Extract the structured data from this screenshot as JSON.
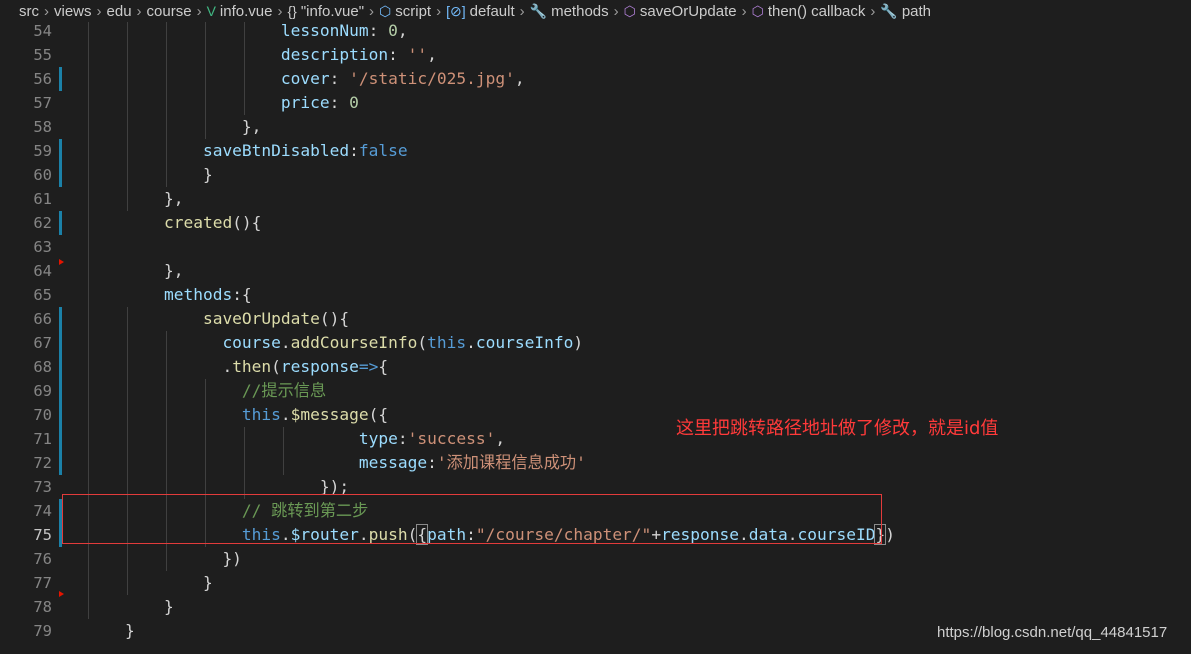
{
  "breadcrumb": [
    {
      "label": "src",
      "icon": ""
    },
    {
      "label": "views",
      "icon": ""
    },
    {
      "label": "edu",
      "icon": ""
    },
    {
      "label": "course",
      "icon": ""
    },
    {
      "label": "info.vue",
      "icon": "vue-file-icon",
      "glyph": "V",
      "color": "#41b883"
    },
    {
      "label": "\"info.vue\"",
      "icon": "object-braces-icon",
      "glyph": "{}",
      "color": "#cccccc"
    },
    {
      "label": "script",
      "icon": "cube-icon",
      "glyph": "⬡",
      "color": "#75beff"
    },
    {
      "label": "default",
      "icon": "bracket-symbol-icon",
      "glyph": "[⊘]",
      "color": "#75beff"
    },
    {
      "label": "methods",
      "icon": "wrench-icon",
      "glyph": "🔧",
      "color": "#cccccc"
    },
    {
      "label": "saveOrUpdate",
      "icon": "method-cube-icon",
      "glyph": "⬡",
      "color": "#b180d7"
    },
    {
      "label": "then() callback",
      "icon": "method-cube-icon",
      "glyph": "⬡",
      "color": "#b180d7"
    },
    {
      "label": "path",
      "icon": "wrench-icon",
      "glyph": "🔧",
      "color": "#cccccc"
    }
  ],
  "editor": {
    "active_line": 75,
    "lines": [
      {
        "n": 54,
        "t": [
          [
            "v",
            "                    lessonNum"
          ],
          [
            "p",
            ": "
          ],
          [
            "n",
            "0"
          ],
          [
            "p",
            ","
          ]
        ]
      },
      {
        "n": 55,
        "t": [
          [
            "v",
            "                    description"
          ],
          [
            "p",
            ": "
          ],
          [
            "s",
            "''"
          ],
          [
            "p",
            ","
          ]
        ]
      },
      {
        "n": 56,
        "t": [
          [
            "v",
            "                    cover"
          ],
          [
            "p",
            ": "
          ],
          [
            "s",
            "'/static/025.jpg'"
          ],
          [
            "p",
            ","
          ]
        ]
      },
      {
        "n": 57,
        "t": [
          [
            "v",
            "                    price"
          ],
          [
            "p",
            ": "
          ],
          [
            "n",
            "0"
          ]
        ]
      },
      {
        "n": 58,
        "t": [
          [
            "p",
            "                },"
          ]
        ]
      },
      {
        "n": 59,
        "t": [
          [
            "v",
            "            saveBtnDisabled"
          ],
          [
            "p",
            ":"
          ],
          [
            "k",
            "false"
          ]
        ]
      },
      {
        "n": 60,
        "t": [
          [
            "p",
            "            }"
          ]
        ]
      },
      {
        "n": 61,
        "t": [
          [
            "p",
            "        },"
          ]
        ]
      },
      {
        "n": 62,
        "t": [
          [
            "f",
            "        created"
          ],
          [
            "p",
            "(){"
          ]
        ]
      },
      {
        "n": 63,
        "t": [
          [
            "p",
            ""
          ]
        ]
      },
      {
        "n": 64,
        "t": [
          [
            "p",
            "        },"
          ]
        ]
      },
      {
        "n": 65,
        "t": [
          [
            "v",
            "        methods"
          ],
          [
            "p",
            ":{"
          ]
        ]
      },
      {
        "n": 66,
        "t": [
          [
            "f",
            "            saveOrUpdate"
          ],
          [
            "p",
            "(){"
          ]
        ]
      },
      {
        "n": 67,
        "t": [
          [
            "v",
            "              course"
          ],
          [
            "p",
            "."
          ],
          [
            "f",
            "addCourseInfo"
          ],
          [
            "p",
            "("
          ],
          [
            "k",
            "this"
          ],
          [
            "p",
            "."
          ],
          [
            "v",
            "courseInfo"
          ],
          [
            "p",
            ")"
          ]
        ]
      },
      {
        "n": 68,
        "t": [
          [
            "p",
            "              ."
          ],
          [
            "f",
            "then"
          ],
          [
            "p",
            "("
          ],
          [
            "v",
            "response"
          ],
          [
            "k",
            "=>"
          ],
          [
            "p",
            "{"
          ]
        ]
      },
      {
        "n": 69,
        "t": [
          [
            "c",
            "                //提示信息"
          ]
        ]
      },
      {
        "n": 70,
        "t": [
          [
            "k",
            "                this"
          ],
          [
            "p",
            "."
          ],
          [
            "f",
            "$message"
          ],
          [
            "p",
            "({"
          ]
        ]
      },
      {
        "n": 71,
        "t": [
          [
            "v",
            "                            type"
          ],
          [
            "p",
            ":"
          ],
          [
            "s",
            "'success'"
          ],
          [
            "p",
            ","
          ]
        ]
      },
      {
        "n": 72,
        "t": [
          [
            "v",
            "                            message"
          ],
          [
            "p",
            ":"
          ],
          [
            "s",
            "'添加课程信息成功'"
          ]
        ]
      },
      {
        "n": 73,
        "t": [
          [
            "p",
            "                        });"
          ]
        ]
      },
      {
        "n": 74,
        "t": [
          [
            "c",
            "                // 跳转到第二步"
          ]
        ]
      },
      {
        "n": 75,
        "t": [
          [
            "k",
            "                this"
          ],
          [
            "p",
            "."
          ],
          [
            "v",
            "$router"
          ],
          [
            "p",
            "."
          ],
          [
            "f",
            "push"
          ],
          [
            "p",
            "("
          ],
          [
            "pb",
            "{"
          ],
          [
            "v",
            "path"
          ],
          [
            "p",
            ":"
          ],
          [
            "s",
            "\"/course/chapter/\""
          ],
          [
            "p",
            "+"
          ],
          [
            "v",
            "response"
          ],
          [
            "p",
            "."
          ],
          [
            "v",
            "data"
          ],
          [
            "p",
            "."
          ],
          [
            "v",
            "courseID"
          ],
          [
            "pb",
            "}"
          ],
          [
            "p",
            ")"
          ]
        ]
      },
      {
        "n": 76,
        "t": [
          [
            "p",
            "              })"
          ]
        ]
      },
      {
        "n": 77,
        "t": [
          [
            "p",
            "            }"
          ]
        ]
      },
      {
        "n": 78,
        "t": [
          [
            "p",
            "        }"
          ]
        ]
      },
      {
        "n": 79,
        "t": [
          [
            "p",
            "    }"
          ]
        ]
      }
    ]
  },
  "annotation": {
    "text": "这里把跳转路径地址做了修改，就是id值",
    "color": "#ff3a3a"
  },
  "watermark": {
    "text": "https://blog.csdn.net/qq_44841517"
  }
}
